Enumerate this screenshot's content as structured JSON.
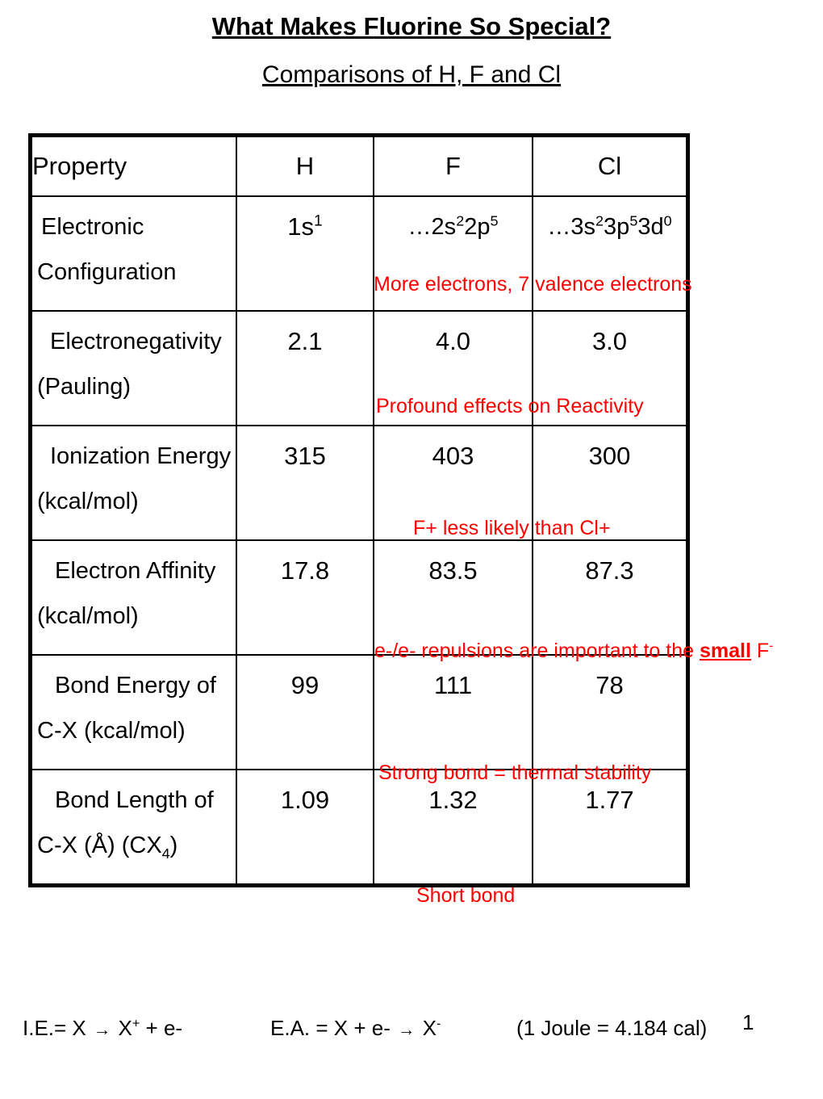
{
  "title": "What Makes Fluorine So Special?",
  "subtitle": "Comparisons of H, F and Cl",
  "table": {
    "headers": [
      "Property",
      "H",
      "F",
      "Cl"
    ],
    "rows": [
      {
        "property_line1": "Electronic",
        "property_line2": "Configuration",
        "h": "1s1",
        "f": "...2s22p5",
        "cl": "...3s23p53d0",
        "note": "More electrons, 7 valence electrons"
      },
      {
        "property_line1": " Electronegativity",
        "property_line2": "(Pauling)",
        "h": "2.1",
        "f": "4.0",
        "cl": "3.0",
        "note": "Profound effects on Reactivity"
      },
      {
        "property_line1": " Ionization Energy",
        "property_line2": "(kcal/mol)",
        "h": "315",
        "f": "403",
        "cl": "300",
        "note": "F+ less likely than Cl+"
      },
      {
        "property_line1": "  Electron Affinity",
        "property_line2": "(kcal/mol)",
        "h": "17.8",
        "f": "83.5",
        "cl": "87.3",
        "note_prefix": "e-/e- repulsions are important to the ",
        "note_bold": "small",
        "note_suffix": " F-"
      },
      {
        "property_line1": "  Bond Energy of",
        "property_line2": "C-X (kcal/mol)",
        "h": "99",
        "f": "111",
        "cl": "78",
        "note": "Strong bond = thermal stability"
      },
      {
        "property_line1": "  Bond Length of",
        "property_line2": "C-X (A) (CX4)",
        "h": "1.09",
        "f": "1.32",
        "cl": "1.77",
        "note": "Short bond"
      }
    ]
  },
  "footer": {
    "ionization_energy": "I.E.= X → X+ + e-",
    "electron_affinity": "E.A. = X + e- → X-",
    "conversion": "(1 Joule = 4.184 cal)",
    "page_number": "1"
  },
  "colors": {
    "annotation": "#ff0000",
    "text": "#000000",
    "border": "#000000",
    "background": "#ffffff"
  }
}
